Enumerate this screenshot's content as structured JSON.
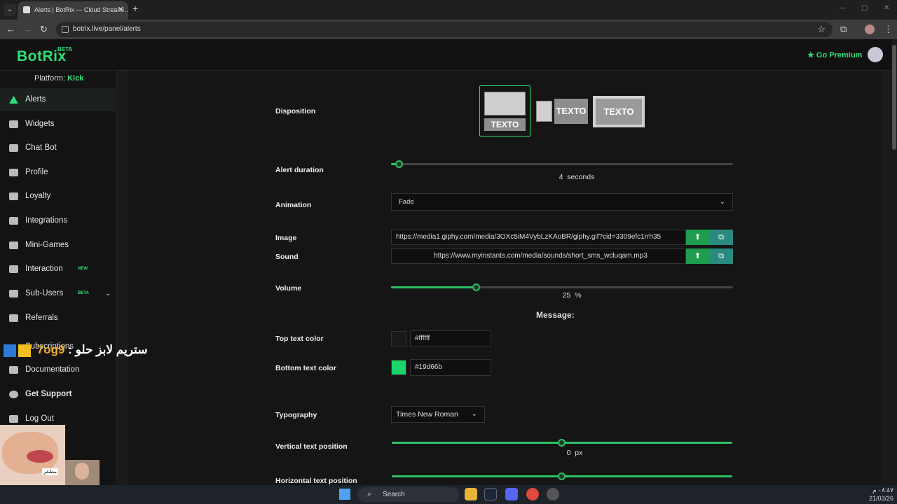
{
  "browser": {
    "tab_title": "Alerts | BotRix — Cloud Streami…",
    "tab_close": "✕",
    "new_tab": "+",
    "url": "botrix.live/panel/alerts",
    "back": "←",
    "forward": "→",
    "reload": "↻"
  },
  "header": {
    "logo": "BotRix",
    "logo_badge": "BETA",
    "premium_label": "Go Premium"
  },
  "sidebar": {
    "platform_label": "Platform:",
    "platform_value": "Kick",
    "items": [
      {
        "label": "Alerts"
      },
      {
        "label": "Widgets"
      },
      {
        "label": "Chat Bot"
      },
      {
        "label": "Profile"
      },
      {
        "label": "Loyalty"
      },
      {
        "label": "Integrations"
      },
      {
        "label": "Mini-Games"
      },
      {
        "label": "Interaction",
        "tag": "NEW"
      },
      {
        "label": "Sub-Users",
        "tag": "BETA"
      },
      {
        "label": "Referrals"
      },
      {
        "label": "Subscriptions"
      },
      {
        "label": "Documentation"
      },
      {
        "label": "Get Support"
      },
      {
        "label": "Log Out"
      }
    ]
  },
  "form": {
    "disposition_label": "Disposition",
    "disposition_text": "TEXTO",
    "alert_duration_label": "Alert duration",
    "alert_duration_value": "4",
    "alert_duration_unit": "seconds",
    "alert_duration_fraction": 0.025,
    "animation_label": "Animation",
    "animation_value": "Fade",
    "image_label": "Image",
    "image_url": "https://media1.giphy.com/media/3OXc5iM4VybLzKAoBR/giphy.gif?cid=3309efc1rrh35",
    "sound_label": "Sound",
    "sound_url": "https://www.myinstants.com/media/sounds/short_sms_wcluqam.mp3",
    "volume_label": "Volume",
    "volume_value": "25",
    "volume_unit": "%",
    "volume_fraction": 0.25,
    "message_title": "Message:",
    "top_color_label": "Top text color",
    "top_color_value": "#ffffff",
    "bottom_color_label": "Bottom text color",
    "bottom_color_value": "#19d66b",
    "typography_label": "Typography",
    "typography_value": "Times New Roman",
    "vertical_label": "Vertical text position",
    "vertical_value": "0",
    "vertical_unit": "px",
    "horizontal_label": "Horizontal text position"
  },
  "overlay": {
    "chat_name": "7og9",
    "chat_separator": ":",
    "chat_message": "ستريم لابز حلو",
    "cam_caption": "مطنقر"
  },
  "taskbar": {
    "search_label": "Search",
    "time": "٠٨:٤٧ م",
    "date": "21/03/26"
  },
  "colors": {
    "accent": "#2ee07a",
    "upload_button": "#1f9d4f",
    "library_button": "#2b8a80"
  }
}
